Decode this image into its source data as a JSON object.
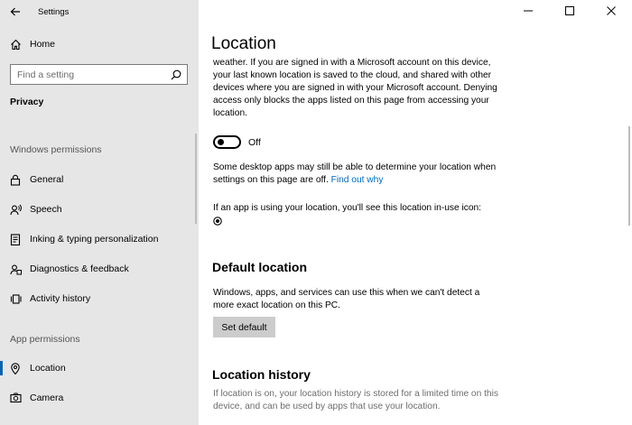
{
  "app": {
    "title": "Settings"
  },
  "sidebar": {
    "home": "Home",
    "search_placeholder": "Find a setting",
    "privacy": "Privacy",
    "windows_permissions_header": "Windows permissions",
    "windows_items": [
      {
        "label": "General",
        "icon": "lock-icon"
      },
      {
        "label": "Speech",
        "icon": "speech-icon"
      },
      {
        "label": "Inking & typing personalization",
        "icon": "inking-icon"
      },
      {
        "label": "Diagnostics & feedback",
        "icon": "diagnostics-icon"
      },
      {
        "label": "Activity history",
        "icon": "activity-icon"
      }
    ],
    "app_permissions_header": "App permissions",
    "app_items": [
      {
        "label": "Location",
        "icon": "location-icon",
        "selected": true
      },
      {
        "label": "Camera",
        "icon": "camera-icon",
        "selected": false
      }
    ]
  },
  "main": {
    "title": "Location",
    "intro_text": "weather. If you are signed in with a Microsoft account on this device, your last known location is saved to the cloud, and shared with other devices where you are signed in with your Microsoft account. Denying access only blocks the apps listed on this page from accessing your location.",
    "toggle_state": "Off",
    "desktop_note": "Some desktop apps may still be able to determine your location when settings on this page are off.",
    "find_out_link": "Find out why",
    "inuse_note": "If an app is using your location, you'll see this location in-use icon:",
    "default_location": {
      "heading": "Default location",
      "text": "Windows, apps, and services can use this when we can't detect a more exact location on this PC.",
      "button": "Set default"
    },
    "location_history": {
      "heading": "Location history",
      "text": "If location is on, your location history is stored for a limited time on this device, and can be used by apps that use your location."
    }
  },
  "colors": {
    "accent": "#0063b1",
    "link": "#0067b8",
    "sidebar_bg": "#e6e6e6"
  }
}
